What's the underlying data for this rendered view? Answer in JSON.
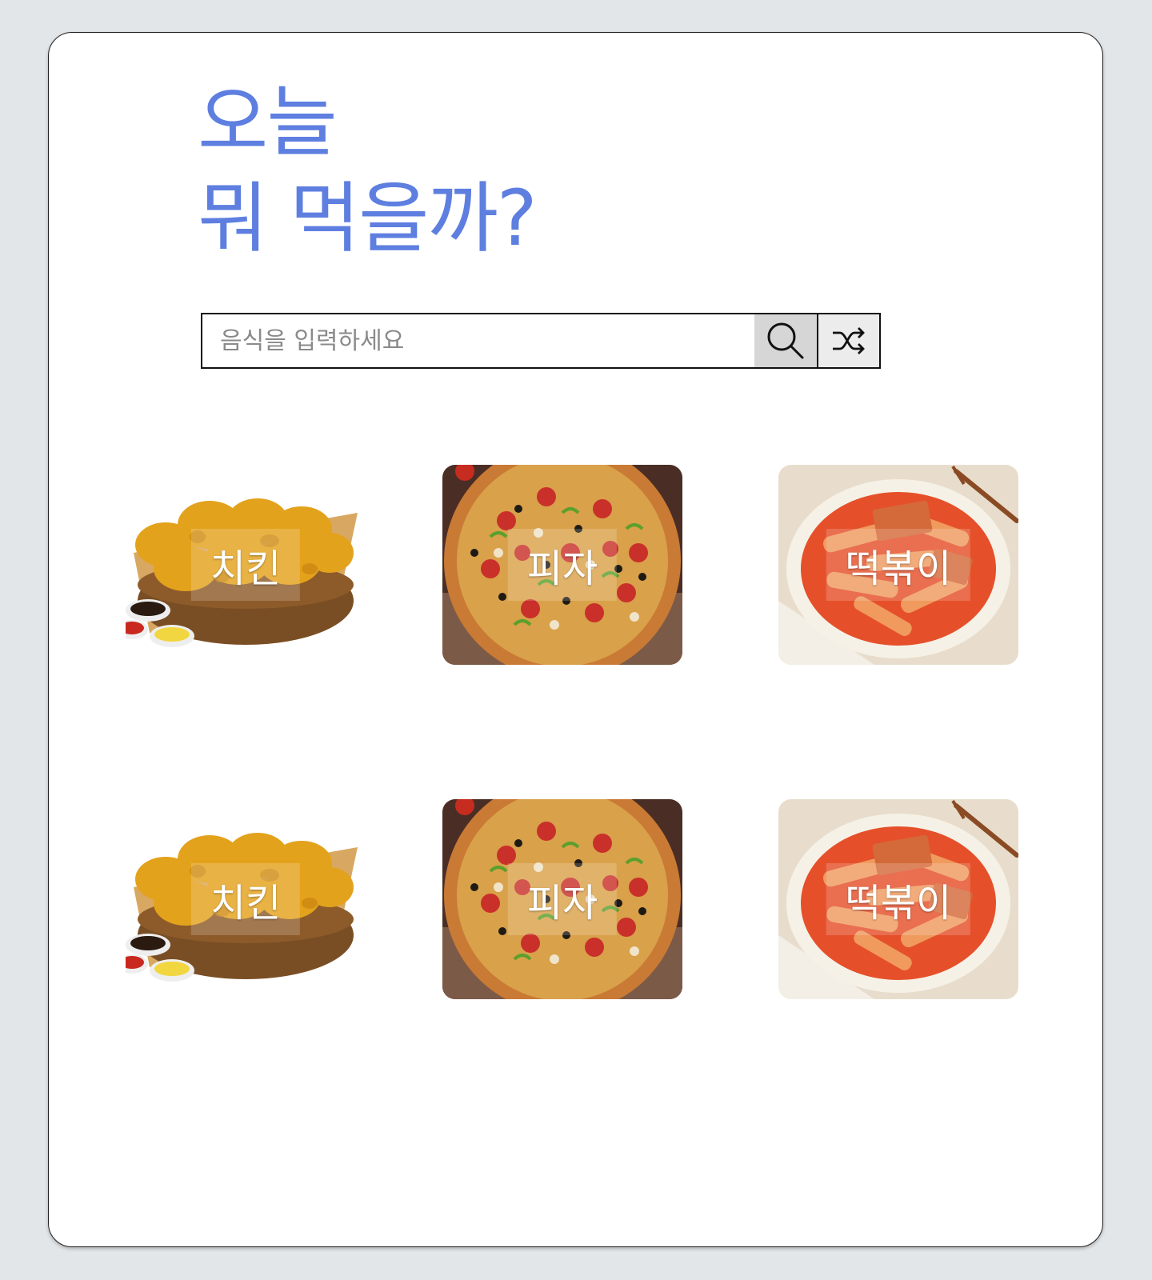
{
  "header": {
    "title_line1": "오늘",
    "title_line2": "뭐 먹을까?"
  },
  "search": {
    "placeholder": "음식을 입력하세요",
    "value": "",
    "search_icon": "search-icon",
    "shuffle_icon": "shuffle-icon"
  },
  "colors": {
    "title": "#5e7fe0",
    "background": "#e2e6e8",
    "card": "#ffffff"
  },
  "foods": [
    {
      "label": "치킨",
      "image": "fried-chicken-basket"
    },
    {
      "label": "피자",
      "image": "pizza"
    },
    {
      "label": "떡볶이",
      "image": "tteokbokki-bowl"
    },
    {
      "label": "치킨",
      "image": "fried-chicken-basket"
    },
    {
      "label": "피자",
      "image": "pizza"
    },
    {
      "label": "떡볶이",
      "image": "tteokbokki-bowl"
    }
  ]
}
